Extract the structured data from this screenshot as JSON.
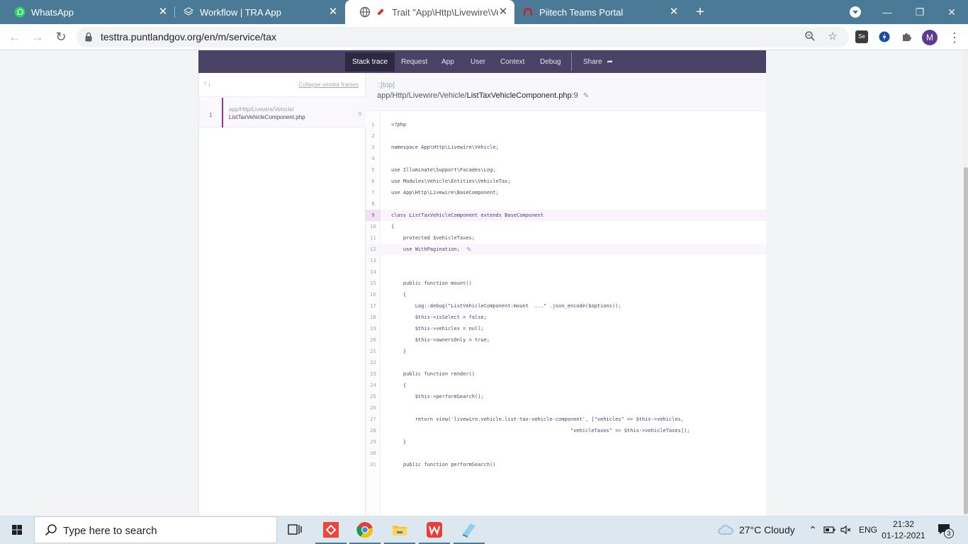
{
  "browser": {
    "tabs": [
      {
        "title": "WhatsApp",
        "icon": "whatsapp-icon"
      },
      {
        "title": "Workflow | TRA App",
        "icon": "layers-icon"
      },
      {
        "title": "Trait \"App\\Http\\Livewire\\Vehi",
        "icon": "globe-icon",
        "active": true
      },
      {
        "title": "Piitech Teams Portal",
        "icon": "arch-icon"
      }
    ],
    "url": "testtra.puntlandgov.org/en/m/service/tax",
    "avatar_letter": "M",
    "ext_se_label": "Se"
  },
  "ignition": {
    "tabs": [
      "Stack trace",
      "Request",
      "App",
      "User",
      "Context",
      "Debug"
    ],
    "share_label": "Share",
    "collapse_label": "Collapse vendor frames",
    "frame": {
      "number": "1",
      "path_dir": "app/Http/Livewire/Vehicle/",
      "path_file": "ListTaxVehicleComponent.php",
      "line": ":9"
    },
    "class_label": "::[top]",
    "file_dir": "app/Http/Livewire/Vehicle/",
    "file_name": "ListTaxVehicleComponent.php",
    "file_line": ":9",
    "highlight_line": 9,
    "code": [
      {
        "n": "1",
        "t": "<?php"
      },
      {
        "n": "2",
        "t": ""
      },
      {
        "n": "3",
        "t": "namespace App\\Http\\Livewire\\Vehicle;"
      },
      {
        "n": "4",
        "t": ""
      },
      {
        "n": "5",
        "t": "use Illuminate\\Support\\Facades\\Log;"
      },
      {
        "n": "6",
        "t": "use Modules\\Vehicle\\Entities\\VehicleTax;"
      },
      {
        "n": "7",
        "t": "use App\\Http\\Livewire\\BaseComponent;"
      },
      {
        "n": "8",
        "t": ""
      },
      {
        "n": "9",
        "t": "class ListTaxVehicleComponent extends BaseComponent"
      },
      {
        "n": "10",
        "t": "{"
      },
      {
        "n": "11",
        "t": "    protected $vehicleTaxes;"
      },
      {
        "n": "12",
        "t": "    use WithPagination;"
      },
      {
        "n": "13",
        "t": ""
      },
      {
        "n": "14",
        "t": ""
      },
      {
        "n": "15",
        "t": "    public function mount()"
      },
      {
        "n": "16",
        "t": "    {"
      },
      {
        "n": "17",
        "t": "        Log::debug(\"ListVehicleComponent:mount  ...\" .json_encode($options));"
      },
      {
        "n": "18",
        "t": "        $this->isSelect = false;"
      },
      {
        "n": "19",
        "t": "        $this->vehicles = null;"
      },
      {
        "n": "20",
        "t": "        $this->ownersOnly = true;"
      },
      {
        "n": "21",
        "t": "    }"
      },
      {
        "n": "22",
        "t": ""
      },
      {
        "n": "23",
        "t": "    public function render()"
      },
      {
        "n": "24",
        "t": "    {"
      },
      {
        "n": "25",
        "t": "        $this->performSearch();"
      },
      {
        "n": "26",
        "t": ""
      },
      {
        "n": "27",
        "t": "        return view('livewire.vehicle.list-tax-vehicle-component', [\"vehicles\" => $this->vehicles,"
      },
      {
        "n": "28",
        "t": "                                                            \"vehicleTaxes\" => $this->vehicleTaxes]);"
      },
      {
        "n": "29",
        "t": "    }"
      },
      {
        "n": "30",
        "t": ""
      },
      {
        "n": "31",
        "t": "    public function performSearch()"
      }
    ]
  },
  "taskbar": {
    "search_placeholder": "Type here to search",
    "weather": "27°C  Cloudy",
    "language": "ENG",
    "time": "21:32",
    "date": "01-12-2021",
    "notification_count": "3"
  }
}
